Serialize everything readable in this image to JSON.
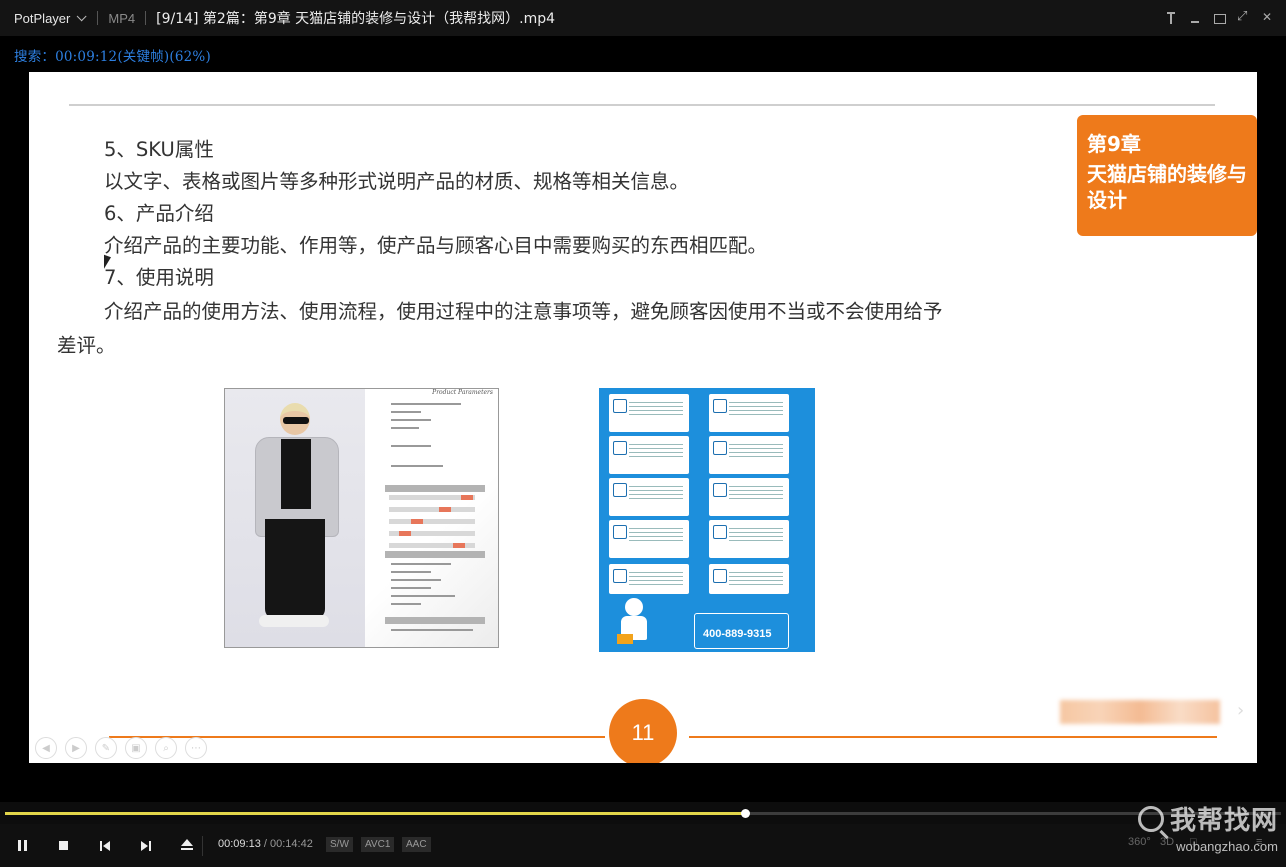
{
  "player": {
    "brand": "PotPlayer",
    "format": "MP4",
    "title": "[9/14] 第2篇：第9章 天猫店铺的装修与设计（我帮找网）.mp4"
  },
  "osd": "搜索：00:09:12(关键帧)(62%)",
  "slide": {
    "lines": [
      "5、SKU属性",
      "以文字、表格或图片等多种形式说明产品的材质、规格等相关信息。",
      "6、产品介绍",
      "介绍产品的主要功能、作用等，使产品与顾客心目中需要购买的东西相匹配。",
      "7、使用说明",
      "介绍产品的使用方法、使用流程，使用过程中的注意事项等，避免顾客因使用不当或不会使用给予",
      "差评。"
    ],
    "badge": {
      "chapter": "第9章",
      "title": "天猫店铺的装修与设计"
    },
    "product_card_header": "Product Parameters",
    "service_phone": "400-889-9315",
    "page_number": "11"
  },
  "playback": {
    "current": "00:09:13",
    "separator": "/",
    "total": "00:14:42",
    "progress_fraction": 0.62,
    "tags": [
      "S/W",
      "AVC1",
      "AAC"
    ],
    "right_labels": [
      "360°",
      "3D",
      "□",
      "≡"
    ]
  },
  "watermark": {
    "cn": "我帮找网",
    "en": "wobangzhao.com"
  },
  "colors": {
    "accent_orange": "#ee7a1b",
    "osd_blue": "#2d7fe0",
    "seek_yellow": "#e2d64a"
  }
}
